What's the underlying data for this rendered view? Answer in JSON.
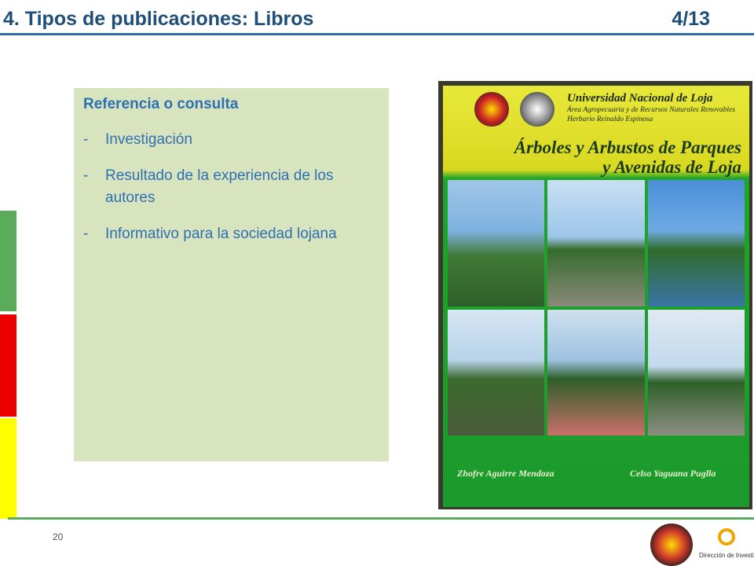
{
  "slide": {
    "title": "4. Tipos de publicaciones: Libros",
    "counter": "4/13",
    "page_number": "20"
  },
  "content": {
    "heading": "Referencia o consulta",
    "bullets": [
      "Investigación",
      "Resultado de la experiencia de los autores",
      "Informativo para la sociedad lojana"
    ]
  },
  "book_cover": {
    "university": "Universidad Nacional de Loja",
    "area": "Área Agropecuaria y de Recursos Naturales Renovables",
    "herbarium": "Herbario Reinaldo Espinosa",
    "title_line1": "Árboles y Arbustos de Parques",
    "title_line2": "y Avenidas de Loja",
    "author1": "Zhofre Aguirre Mendoza",
    "author2": "Celso Yaguana Puglla"
  },
  "footer": {
    "logo_text": "Dirección de Investigación"
  },
  "colors": {
    "title": "#1f4e79",
    "content_background": "#d7e4bd",
    "content_text": "#2f6fb5",
    "bar_green": "#5aac5a",
    "bar_red": "#ee0000",
    "bar_yellow": "#ffff00"
  }
}
